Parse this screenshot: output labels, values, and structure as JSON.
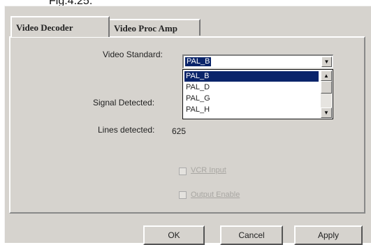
{
  "caption": "Fig.4.25.",
  "tabs": [
    {
      "label": "Video Decoder"
    },
    {
      "label": "Video Proc Amp"
    }
  ],
  "form": {
    "video_standard": {
      "label": "Video Standard:",
      "value": "PAL_B",
      "options": [
        "PAL_B",
        "PAL_D",
        "PAL_G",
        "PAL_H"
      ],
      "highlighted": "PAL_B"
    },
    "signal_detected": {
      "label": "Signal Detected:"
    },
    "lines_detected": {
      "label": "Lines detected:",
      "value": "625"
    },
    "vcr_input": {
      "label": "VCR Input",
      "checked": false,
      "enabled": false
    },
    "output_enable": {
      "label": "Output Enable",
      "checked": false,
      "enabled": false
    }
  },
  "buttons": {
    "ok": "OK",
    "cancel": "Cancel",
    "apply": "Apply"
  },
  "colors": {
    "dialog_bg": "#d6d3ce",
    "selection": "#0a246a"
  }
}
